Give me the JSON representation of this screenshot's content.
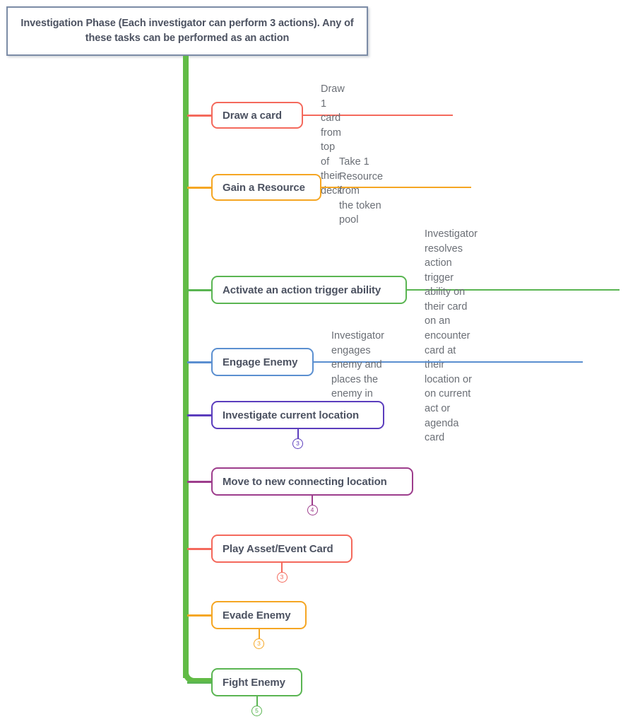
{
  "diagram": {
    "type": "mindmap",
    "title": "Investigation Phase actions mind map",
    "root": {
      "text": "Investigation Phase (Each investigator can perform 3 actions). Any of these tasks can be performed as an action",
      "border_color": "#7c8ca6",
      "text_color": "#4c5261"
    },
    "trunk_color": "#62bb46",
    "branches": [
      {
        "label": "Draw  a card",
        "color": "#f4695c",
        "annotation": "Draw 1 card from top of\ntheir deck",
        "badge": ""
      },
      {
        "label": "Gain a Resource",
        "color": "#f5a623",
        "annotation": "Take 1 Resource from\nthe token pool",
        "badge": ""
      },
      {
        "label": "Activate an action trigger ability",
        "color": "#5ab552",
        "annotation": "Investigator resolves action trigger\nability on their card on an\nencounter card at their location or\non current act or agenda card",
        "badge": ""
      },
      {
        "label": "Engage Enemy",
        "color": "#5b8fd0",
        "annotation": "Investigator engages enemy and places the\nenemy in their threat area",
        "badge": ""
      },
      {
        "label": "Investigate current location",
        "color": "#5b3dbd",
        "annotation": "",
        "badge": "3"
      },
      {
        "label": "Move to new connecting location",
        "color": "#9d3d8c",
        "annotation": "",
        "badge": "4"
      },
      {
        "label": "Play Asset/Event Card",
        "color": "#f4695c",
        "annotation": "",
        "badge": "3"
      },
      {
        "label": "Evade Enemy",
        "color": "#f5a623",
        "annotation": "",
        "badge": "3"
      },
      {
        "label": "Fight Enemy",
        "color": "#5ab552",
        "annotation": "",
        "badge": "5"
      }
    ]
  }
}
